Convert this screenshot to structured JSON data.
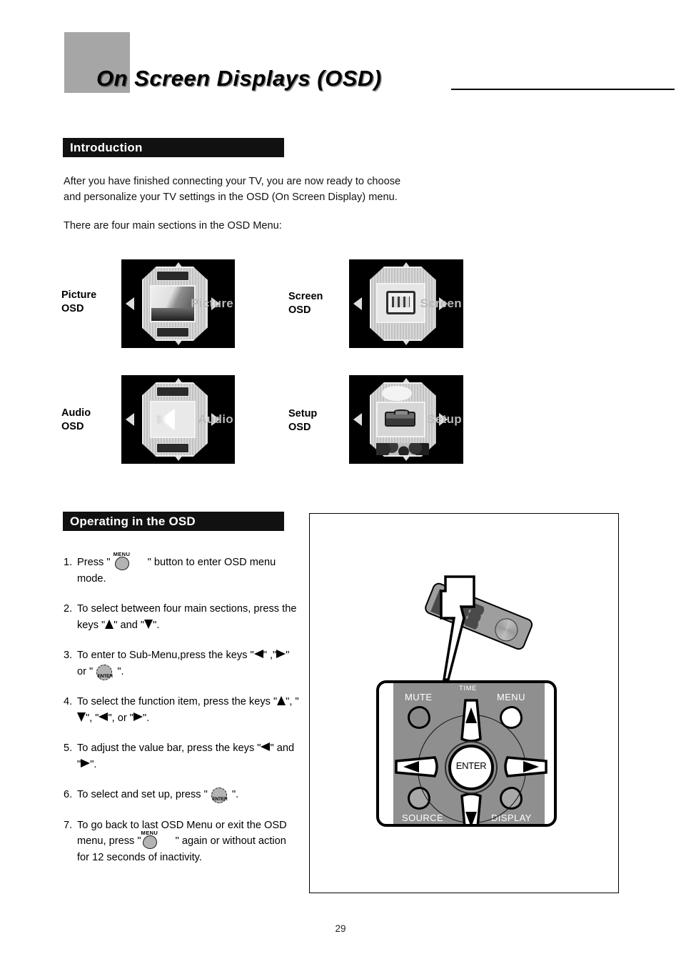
{
  "page": {
    "title": "On Screen Displays (OSD)",
    "number": "29"
  },
  "introduction": {
    "heading": "Introduction",
    "paragraph1": "After you have finished connecting your TV, you are now ready to choose\nand personalize your TV settings in the OSD (On Screen Display) menu.",
    "paragraph2": "There are four main sections in the OSD Menu:"
  },
  "osd_sections": [
    {
      "label": "Picture\nOSD",
      "caption": "Picture"
    },
    {
      "label": "Screen\nOSD",
      "caption": "Screen"
    },
    {
      "label": "Audio\nOSD",
      "caption": "Audio"
    },
    {
      "label": "Setup\nOSD",
      "caption": "Setup"
    }
  ],
  "operating": {
    "heading": "Operating in the OSD",
    "steps": [
      {
        "num": "1.",
        "part1": "Press \" ",
        "glyph": "menu-button",
        "glyph_label": "MENU",
        "part2": " \" button to enter OSD menu mode."
      },
      {
        "num": "2.",
        "part1": "To select between four main sections, press the keys \"",
        "part2": "\" and \"",
        "part3": "\"."
      },
      {
        "num": "3.",
        "part1": "To enter to Sub-Menu,press the keys \"",
        "part2": "\" ,\"",
        "part3": "\" or \" ",
        "glyph_label": "ENTER",
        "part4": " \"."
      },
      {
        "num": "4.",
        "part1": "To select the function item, press the keys \"",
        "part2": "\", \"",
        "part3": "\", \"",
        "part4": "\", or \"",
        "part5": "\"."
      },
      {
        "num": "5.",
        "part1": "To adjust the value bar, press the keys \"",
        "part2": "\" and \"",
        "part3": "\"."
      },
      {
        "num": "6.",
        "part1": "To select and set up, press \" ",
        "glyph_label": "ENTER",
        "part2": " \"."
      },
      {
        "num": "7.",
        "part1": "To go back to last OSD Menu or exit the OSD menu, press \"",
        "glyph_label": "MENU",
        "part2": " \" again or without action for 12 seconds of inactivity."
      }
    ]
  },
  "keypad": {
    "mute": "MUTE",
    "menu": "MENU",
    "time": "TIME",
    "source": "SOURCE",
    "display": "DISPLAY",
    "enter": "ENTER"
  },
  "colors": {
    "header_block": "#a6a6a6",
    "section_bar": "#111111",
    "section_bar_text": "#ffffff",
    "keypad_face": "#8f8f8f",
    "button_gray": "#b3b3b3",
    "page_background": "#ffffff"
  }
}
